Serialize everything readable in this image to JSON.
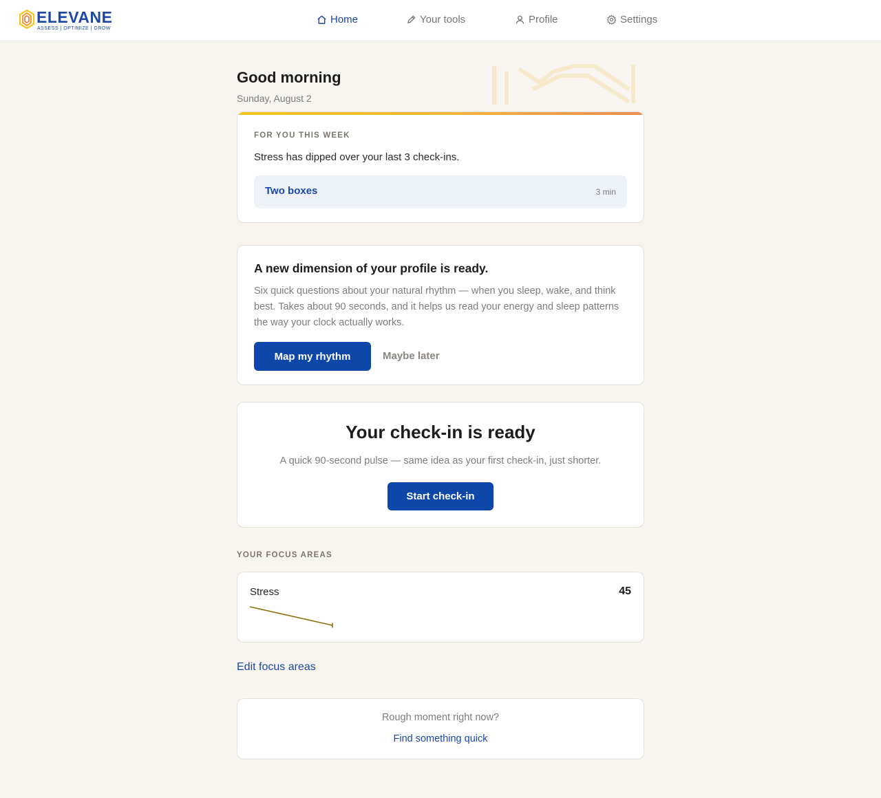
{
  "brand": {
    "name": "ELEVANE",
    "tagline": "ASSESS | OPTIMIZE | GROW",
    "color": "#1a47a8"
  },
  "nav": {
    "items": [
      {
        "label": "Home",
        "icon": "home-icon",
        "active": true
      },
      {
        "label": "Your tools",
        "icon": "pencil-icon",
        "active": false
      },
      {
        "label": "Profile",
        "icon": "user-icon",
        "active": false
      },
      {
        "label": "Settings",
        "icon": "gear-icon",
        "active": false
      }
    ]
  },
  "header": {
    "greeting": "Good morning",
    "date": "Sunday, August 2"
  },
  "week_card": {
    "eyebrow": "FOR YOU THIS WEEK",
    "message": "Stress has dipped over your last 3 check-ins.",
    "tool_name": "Two boxes",
    "tool_duration": "3 min"
  },
  "dimension_card": {
    "title": "A new dimension of your profile is ready.",
    "body": "Six quick questions about your natural rhythm — when you sleep, wake, and think best. Takes about 90 seconds, and it helps us read your energy and sleep patterns the way your clock actually works.",
    "primary_label": "Map my rhythm",
    "secondary_label": "Maybe later"
  },
  "checkin_card": {
    "title": "Your check-in is ready",
    "subtitle": "A quick 90-second pulse — same idea as your first check-in, just shorter.",
    "button_label": "Start check-in"
  },
  "focus": {
    "section_title": "YOUR FOCUS AREAS",
    "areas": [
      {
        "label": "Stress",
        "score": "45",
        "trend_color": "#8a6d0a"
      }
    ],
    "edit_label": "Edit focus areas"
  },
  "rough_card": {
    "question": "Rough moment right now?",
    "link_label": "Find something quick"
  },
  "colors": {
    "accent": "#0d47a9",
    "background": "#f8f4ef",
    "gradient_start": "#f5c518",
    "gradient_end": "#ee8a52"
  }
}
